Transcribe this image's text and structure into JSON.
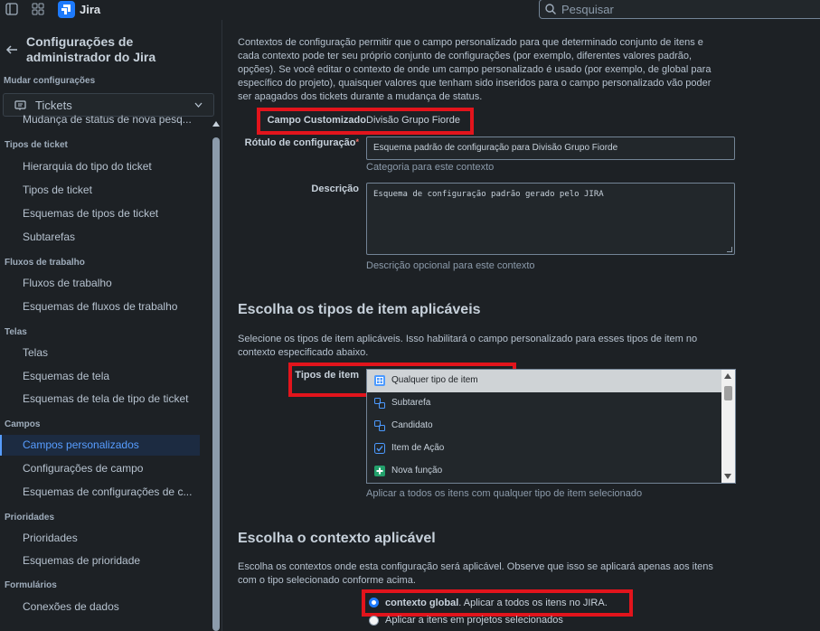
{
  "topbar": {
    "app_name": "Jira",
    "search_placeholder": "Pesquisar"
  },
  "sidebar": {
    "title": "Configurações de administrador do Jira",
    "change_settings": "Mudar configurações",
    "ticket_select": "Tickets",
    "items": [
      {
        "type": "item",
        "label": "Mudança de status de nova pesq..."
      },
      {
        "type": "section",
        "label": "Tipos de ticket"
      },
      {
        "type": "item",
        "label": "Hierarquia do tipo do ticket"
      },
      {
        "type": "item",
        "label": "Tipos de ticket"
      },
      {
        "type": "item",
        "label": "Esquemas de tipos de ticket"
      },
      {
        "type": "item",
        "label": "Subtarefas"
      },
      {
        "type": "section",
        "label": "Fluxos de trabalho"
      },
      {
        "type": "item",
        "label": "Fluxos de trabalho"
      },
      {
        "type": "item",
        "label": "Esquemas de fluxos de trabalho"
      },
      {
        "type": "section",
        "label": "Telas"
      },
      {
        "type": "item",
        "label": "Telas"
      },
      {
        "type": "item",
        "label": "Esquemas de tela"
      },
      {
        "type": "item",
        "label": "Esquemas de tela de tipo de ticket"
      },
      {
        "type": "section",
        "label": "Campos"
      },
      {
        "type": "item",
        "label": "Campos personalizados",
        "active": true
      },
      {
        "type": "item",
        "label": "Configurações de campo"
      },
      {
        "type": "item",
        "label": "Esquemas de configurações de c..."
      },
      {
        "type": "section",
        "label": "Prioridades"
      },
      {
        "type": "item",
        "label": "Prioridades"
      },
      {
        "type": "item",
        "label": "Esquemas de prioridade"
      },
      {
        "type": "section",
        "label": "Formulários"
      },
      {
        "type": "item",
        "label": "Conexões de dados"
      }
    ]
  },
  "main": {
    "intro": "Contextos de configuração permitir que o campo personalizado para que determinado conjunto de itens e cada contexto pode ter seu próprio conjunto de configurações (por exemplo, diferentes valores padrão, opções). Se você editar o contexto de onde um campo personalizado é usado (por exemplo, de global para específico do projeto), quaisquer valores que tenham sido inseridos para o campo personalizado vão poder ser apagados dos tickets durante a mudança de status.",
    "custom_field_label": "Campo Customizado",
    "custom_field_value": "Divisão Grupo Fiorde",
    "config_label": "Rótulo de configuração",
    "config_required_mark": "*",
    "config_value": "Esquema padrão de configuração para Divisão Grupo Fiorde",
    "config_help": "Categoria para este contexto",
    "description_label": "Descrição",
    "description_value": "Esquema de configuração padrão gerado pelo JIRA",
    "description_help": "Descrição opcional para este contexto",
    "item_types_heading": "Escolha os tipos de item aplicáveis",
    "item_types_para": "Selecione os tipos de item aplicáveis. Isso habilitará o campo personalizado para esses tipos de item no contexto especificado abaixo.",
    "item_types_label": "Tipos de item",
    "item_types": [
      {
        "label": "Qualquer tipo de item",
        "icon": "any-type-icon",
        "color": "#4c9aff",
        "selected": true
      },
      {
        "label": "Subtarefa",
        "icon": "subtask-icon",
        "color": "#4c9aff",
        "selected": false
      },
      {
        "label": "Candidato",
        "icon": "subtask-icon",
        "color": "#4c9aff",
        "selected": false
      },
      {
        "label": "Item de Ação",
        "icon": "checkbox-icon",
        "color": "#4c9aff",
        "selected": false
      },
      {
        "label": "Nova função",
        "icon": "plus-icon",
        "color": "#22a06b",
        "selected": false
      }
    ],
    "item_types_help": "Aplicar a todos os itens com qualquer tipo de item selecionado",
    "context_heading": "Escolha o contexto aplicável",
    "context_para": "Escolha os contextos onde esta configuração será aplicável. Observe que isso se aplicará apenas aos itens com o tipo selecionado conforme acima.",
    "context_options": [
      {
        "bold": "contexto global",
        "rest": ". Aplicar a todos os itens no JIRA.",
        "checked": true
      },
      {
        "bold": "",
        "rest": "Aplicar a itens em projetos selecionados",
        "checked": false
      }
    ]
  },
  "colors": {
    "highlight_box": "#e2141c",
    "accent": "#579dff"
  }
}
